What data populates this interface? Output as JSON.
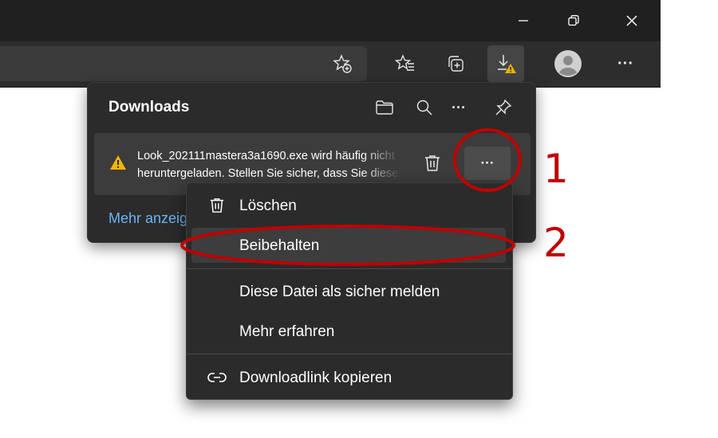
{
  "window_controls": {
    "minimize": "—",
    "close": "✕"
  },
  "toolbar": {
    "buttons": [
      {
        "icon": "favorite-add-icon"
      },
      {
        "icon": "favorites-icon"
      },
      {
        "icon": "collections-icon"
      },
      {
        "icon": "downloads-warning-icon",
        "active": true
      },
      {
        "icon": "profile-icon"
      },
      {
        "icon": "settings-more-icon",
        "label": "···"
      }
    ]
  },
  "downloads_panel": {
    "title": "Downloads",
    "header_more": "···",
    "item": {
      "line1": "Look_202111mastera3a1690.exe wird häufig nicht",
      "line2": "heruntergeladen. Stellen Sie sicher, dass Sie dieser Datei",
      "more_label": "···"
    },
    "more_link": "Mehr anzeigen"
  },
  "context_menu": {
    "items": [
      {
        "label": "Löschen",
        "icon": "trash-icon"
      },
      {
        "label": "Beibehalten"
      },
      {
        "label": "Diese Datei als sicher melden"
      },
      {
        "label": "Mehr erfahren"
      },
      {
        "label": "Downloadlink kopieren",
        "icon": "link-icon"
      }
    ]
  },
  "annotations": {
    "marker_1": "1",
    "marker_2": "2",
    "color": "#c00000"
  },
  "colors": {
    "titlebar": "#202020",
    "toolbar": "#2d2d2d",
    "panel": "#2b2b2b",
    "warning": "#f4b400",
    "link": "#6cb4f2"
  }
}
